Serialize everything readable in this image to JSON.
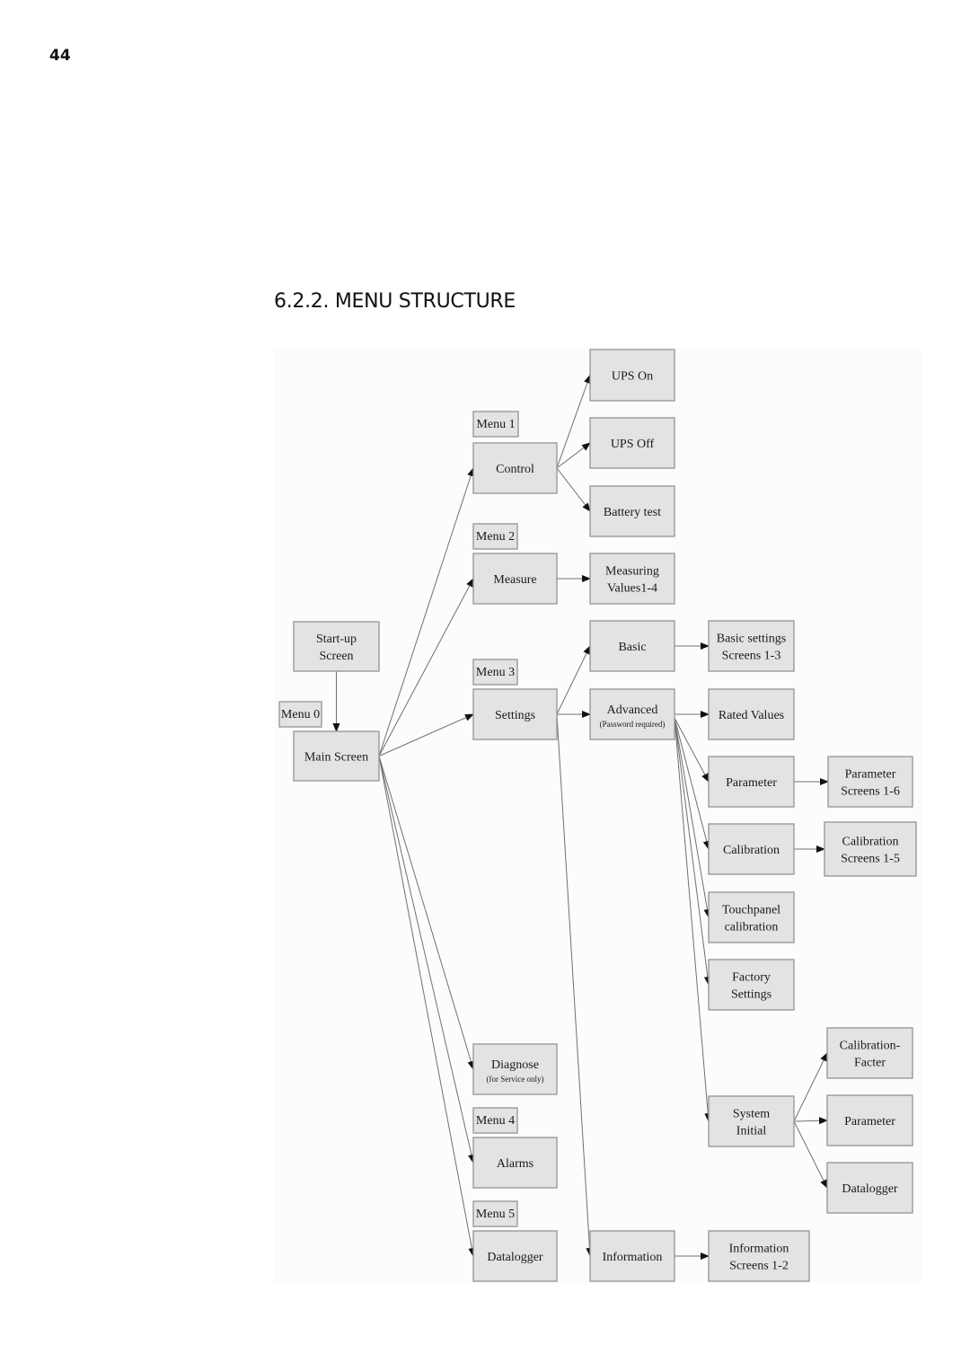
{
  "page": {
    "number": "44",
    "section_title": "6.2.2. MENU STRUCTURE"
  },
  "diagram": {
    "colors": {
      "box_fill": "#e3e3e3",
      "box_border": "#9a9a9a",
      "edge": "#707070",
      "text": "#1a1a1a"
    },
    "nodes": [
      {
        "id": "startup",
        "lines": [
          "Start-up",
          "Screen"
        ]
      },
      {
        "id": "menu0",
        "lines": [
          "Menu 0"
        ],
        "tag": true
      },
      {
        "id": "main",
        "lines": [
          "Main Screen"
        ]
      },
      {
        "id": "menu1",
        "lines": [
          "Menu 1"
        ],
        "tag": true
      },
      {
        "id": "control",
        "lines": [
          "Control"
        ]
      },
      {
        "id": "menu2",
        "lines": [
          "Menu 2"
        ],
        "tag": true
      },
      {
        "id": "measure",
        "lines": [
          "Measure"
        ]
      },
      {
        "id": "menu3",
        "lines": [
          "Menu 3"
        ],
        "tag": true
      },
      {
        "id": "settings",
        "lines": [
          "Settings"
        ]
      },
      {
        "id": "diagnose",
        "lines": [
          "Diagnose"
        ],
        "sub": "(for Service only)"
      },
      {
        "id": "menu4",
        "lines": [
          "Menu 4"
        ],
        "tag": true
      },
      {
        "id": "alarms",
        "lines": [
          "Alarms"
        ]
      },
      {
        "id": "menu5",
        "lines": [
          "Menu 5"
        ],
        "tag": true
      },
      {
        "id": "datalogger",
        "lines": [
          "Datalogger"
        ]
      },
      {
        "id": "upson",
        "lines": [
          "UPS On"
        ]
      },
      {
        "id": "upsoff",
        "lines": [
          "UPS Off"
        ]
      },
      {
        "id": "battery",
        "lines": [
          "Battery test"
        ]
      },
      {
        "id": "measvals",
        "lines": [
          "Measuring",
          "Values1-4"
        ]
      },
      {
        "id": "basic",
        "lines": [
          "Basic"
        ]
      },
      {
        "id": "advanced",
        "lines": [
          "Advanced"
        ],
        "sub": "(Password required)"
      },
      {
        "id": "information",
        "lines": [
          "Information"
        ]
      },
      {
        "id": "basicscreens",
        "lines": [
          "Basic settings",
          "Screens 1-3"
        ]
      },
      {
        "id": "rated",
        "lines": [
          "Rated Values"
        ]
      },
      {
        "id": "parameter",
        "lines": [
          "Parameter"
        ]
      },
      {
        "id": "calibration",
        "lines": [
          "Calibration"
        ]
      },
      {
        "id": "touch",
        "lines": [
          "Touchpanel",
          "calibration"
        ]
      },
      {
        "id": "factory",
        "lines": [
          "Factory",
          "Settings"
        ]
      },
      {
        "id": "sysinit",
        "lines": [
          "System",
          "Initial"
        ]
      },
      {
        "id": "infoscreens",
        "lines": [
          "Information",
          "Screens 1-2"
        ]
      },
      {
        "id": "paramscreens",
        "lines": [
          "Parameter",
          "Screens 1-6"
        ]
      },
      {
        "id": "calscreens",
        "lines": [
          "Calibration",
          "Screens 1-5"
        ]
      },
      {
        "id": "calfacter",
        "lines": [
          "Calibration-",
          "Facter"
        ]
      },
      {
        "id": "sysparam",
        "lines": [
          "Parameter"
        ]
      },
      {
        "id": "sysdatalogger",
        "lines": [
          "Datalogger"
        ]
      }
    ],
    "edges": [
      [
        "startup",
        "main"
      ],
      [
        "main",
        "control"
      ],
      [
        "main",
        "measure"
      ],
      [
        "main",
        "settings"
      ],
      [
        "main",
        "diagnose"
      ],
      [
        "main",
        "alarms"
      ],
      [
        "main",
        "datalogger"
      ],
      [
        "control",
        "upson"
      ],
      [
        "control",
        "upsoff"
      ],
      [
        "control",
        "battery"
      ],
      [
        "measure",
        "measvals"
      ],
      [
        "settings",
        "basic"
      ],
      [
        "settings",
        "advanced"
      ],
      [
        "settings",
        "information"
      ],
      [
        "basic",
        "basicscreens"
      ],
      [
        "advanced",
        "rated"
      ],
      [
        "advanced",
        "parameter"
      ],
      [
        "advanced",
        "calibration"
      ],
      [
        "advanced",
        "touch"
      ],
      [
        "advanced",
        "factory"
      ],
      [
        "advanced",
        "sysinit"
      ],
      [
        "parameter",
        "paramscreens"
      ],
      [
        "calibration",
        "calscreens"
      ],
      [
        "information",
        "infoscreens"
      ],
      [
        "sysinit",
        "calfacter"
      ],
      [
        "sysinit",
        "sysparam"
      ],
      [
        "sysinit",
        "sysdatalogger"
      ]
    ]
  }
}
